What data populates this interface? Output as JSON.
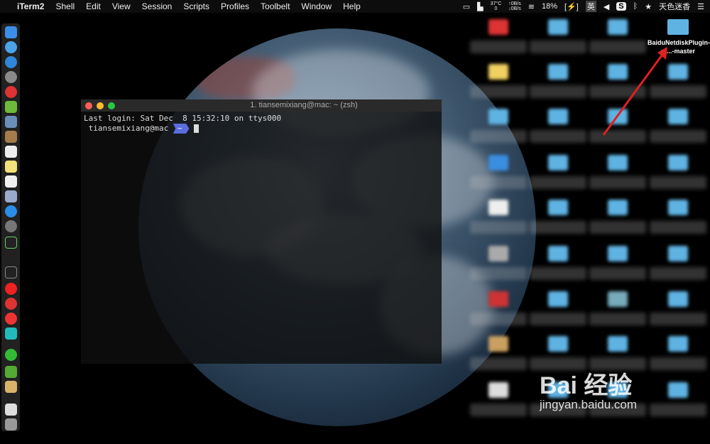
{
  "menubar": {
    "apple": "",
    "app": "iTerm2",
    "items": [
      "Shell",
      "Edit",
      "View",
      "Session",
      "Scripts",
      "Profiles",
      "Toolbelt",
      "Window",
      "Help"
    ],
    "temp": "37°C",
    "temp_sub": "0",
    "net_up": "↑0B/s",
    "net_down": "↓0B/s",
    "battery": "18%",
    "input": "英",
    "user": "天色迷香"
  },
  "terminal": {
    "title": "1. tiansemixiang@mac: ~ (zsh)",
    "last_login": "Last login: Sat Dec  8 15:32:10 on ttys000",
    "prompt_user": "tiansemixiang@mac",
    "prompt_dir": "~"
  },
  "desktop": {
    "highlight_label": "BaiduNetdiskPlugin-m...-master"
  },
  "watermark": {
    "brand": "Bai 经验",
    "url": "jingyan.baidu.com"
  },
  "colors": {
    "accent": "#5a6ee0",
    "arrow": "#e02020"
  }
}
